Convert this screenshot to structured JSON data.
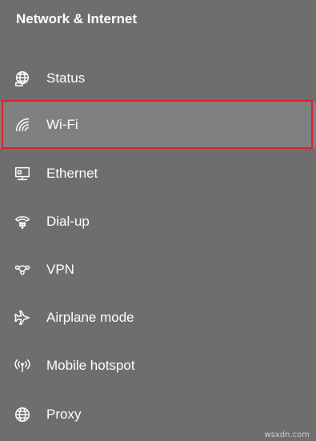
{
  "section": {
    "title": "Network & Internet"
  },
  "nav": {
    "items": [
      {
        "label": "Status",
        "icon": "globe-status-icon"
      },
      {
        "label": "Wi-Fi",
        "icon": "wifi-icon",
        "selected": true
      },
      {
        "label": "Ethernet",
        "icon": "ethernet-icon"
      },
      {
        "label": "Dial-up",
        "icon": "dial-up-icon"
      },
      {
        "label": "VPN",
        "icon": "vpn-icon"
      },
      {
        "label": "Airplane mode",
        "icon": "airplane-icon"
      },
      {
        "label": "Mobile hotspot",
        "icon": "hotspot-icon"
      },
      {
        "label": "Proxy",
        "icon": "globe-proxy-icon"
      }
    ]
  },
  "watermark": "wsxdn.com",
  "colors": {
    "background": "#6e6e6e",
    "selected_background": "#808080",
    "highlight_border": "#e0202c",
    "text": "#ffffff"
  }
}
